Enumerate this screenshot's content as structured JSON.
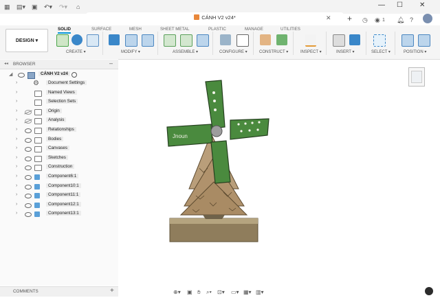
{
  "window": {
    "doc_title": "CÁNH V2 v24*",
    "minimize": "—",
    "maximize": "☐",
    "close": "✕"
  },
  "header": {
    "badge": "1"
  },
  "ribbon": {
    "workspace": "DESIGN",
    "tabs": [
      "SOLID",
      "SURFACE",
      "MESH",
      "SHEET METAL",
      "PLASTIC",
      "MANAGE",
      "UTILITIES"
    ],
    "active_tab": "SOLID",
    "groups": [
      "CREATE",
      "MODIFY",
      "ASSEMBLE",
      "CONFIGURE",
      "CONSTRUCT",
      "INSPECT",
      "INSERT",
      "SELECT",
      "POSITION"
    ]
  },
  "browser": {
    "title": "BROWSER",
    "collapse": "–",
    "root": "CÁNH V2 v24",
    "items": [
      {
        "label": "Document Settings",
        "type": "gear",
        "visible": null
      },
      {
        "label": "Named Views",
        "type": "folder",
        "visible": null
      },
      {
        "label": "Selection Sets",
        "type": "folder",
        "visible": null
      },
      {
        "label": "Origin",
        "type": "folder",
        "visible": false
      },
      {
        "label": "Analysis",
        "type": "folder",
        "visible": false
      },
      {
        "label": "Relationships",
        "type": "folder",
        "visible": true
      },
      {
        "label": "Bodies",
        "type": "folder",
        "visible": true
      },
      {
        "label": "Canvases",
        "type": "folder",
        "visible": true
      },
      {
        "label": "Sketches",
        "type": "folder",
        "visible": true
      },
      {
        "label": "Construction",
        "type": "folder",
        "visible": true
      },
      {
        "label": "Component6:1",
        "type": "component",
        "visible": true
      },
      {
        "label": "Component10:1",
        "type": "component",
        "visible": true
      },
      {
        "label": "Component11:1",
        "type": "component",
        "visible": true
      },
      {
        "label": "Component12:1",
        "type": "component",
        "visible": true
      },
      {
        "label": "Component13:1",
        "type": "component",
        "visible": true
      }
    ]
  },
  "comments": {
    "title": "COMMENTS",
    "add": "+"
  },
  "model": {
    "blade_text": "Jnoun"
  }
}
